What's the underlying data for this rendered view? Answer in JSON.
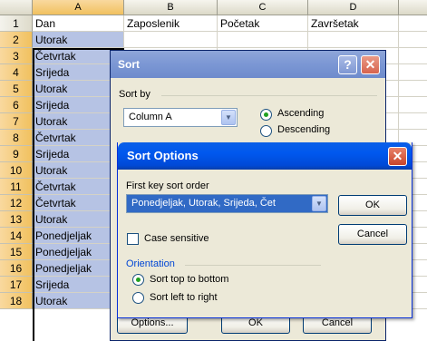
{
  "sheet": {
    "columns": [
      "A",
      "B",
      "C",
      "D"
    ],
    "rows": [
      {
        "n": "1",
        "a": "Dan",
        "b": "Zaposlenik",
        "c": "Početak",
        "d": "Završetak"
      },
      {
        "n": "2",
        "a": "Utorak"
      },
      {
        "n": "3",
        "a": "Četvrtak"
      },
      {
        "n": "4",
        "a": "Srijeda"
      },
      {
        "n": "5",
        "a": "Utorak"
      },
      {
        "n": "6",
        "a": "Srijeda"
      },
      {
        "n": "7",
        "a": "Utorak"
      },
      {
        "n": "8",
        "a": "Četvrtak"
      },
      {
        "n": "9",
        "a": "Srijeda"
      },
      {
        "n": "10",
        "a": "Utorak"
      },
      {
        "n": "11",
        "a": "Četvrtak"
      },
      {
        "n": "12",
        "a": "Četvrtak"
      },
      {
        "n": "13",
        "a": "Utorak"
      },
      {
        "n": "14",
        "a": "Ponedjeljak"
      },
      {
        "n": "15",
        "a": "Ponedjeljak"
      },
      {
        "n": "16",
        "a": "Ponedjeljak"
      },
      {
        "n": "17",
        "a": "Srijeda"
      },
      {
        "n": "18",
        "a": "Utorak"
      }
    ]
  },
  "sort_dialog": {
    "title": "Sort",
    "help_glyph": "?",
    "close_glyph": "✕",
    "sort_by_label": "Sort by",
    "sort_by_value": "Column A",
    "ascending": "Ascending",
    "descending": "Descending",
    "selected_order": "Ascending",
    "options_button": "Options...",
    "ok_button": "OK",
    "cancel_button": "Cancel"
  },
  "sort_options_dialog": {
    "title": "Sort Options",
    "close_glyph": "✕",
    "first_key_label": "First key sort order",
    "first_key_value": "Ponedjeljak, Utorak, Srijeda, Čet",
    "ok_button": "OK",
    "cancel_button": "Cancel",
    "case_sensitive_label": "Case sensitive",
    "case_sensitive_checked": false,
    "orientation_label": "Orientation",
    "orientation_options": [
      "Sort top to bottom",
      "Sort left to right"
    ],
    "orientation_selected": "Sort top to bottom"
  },
  "colors": {
    "selection_fill": "#b6c3e4",
    "header_highlight": "#f1c15f",
    "active_titlebar": "#0058ee",
    "inactive_titlebar": "#7b97d4"
  }
}
